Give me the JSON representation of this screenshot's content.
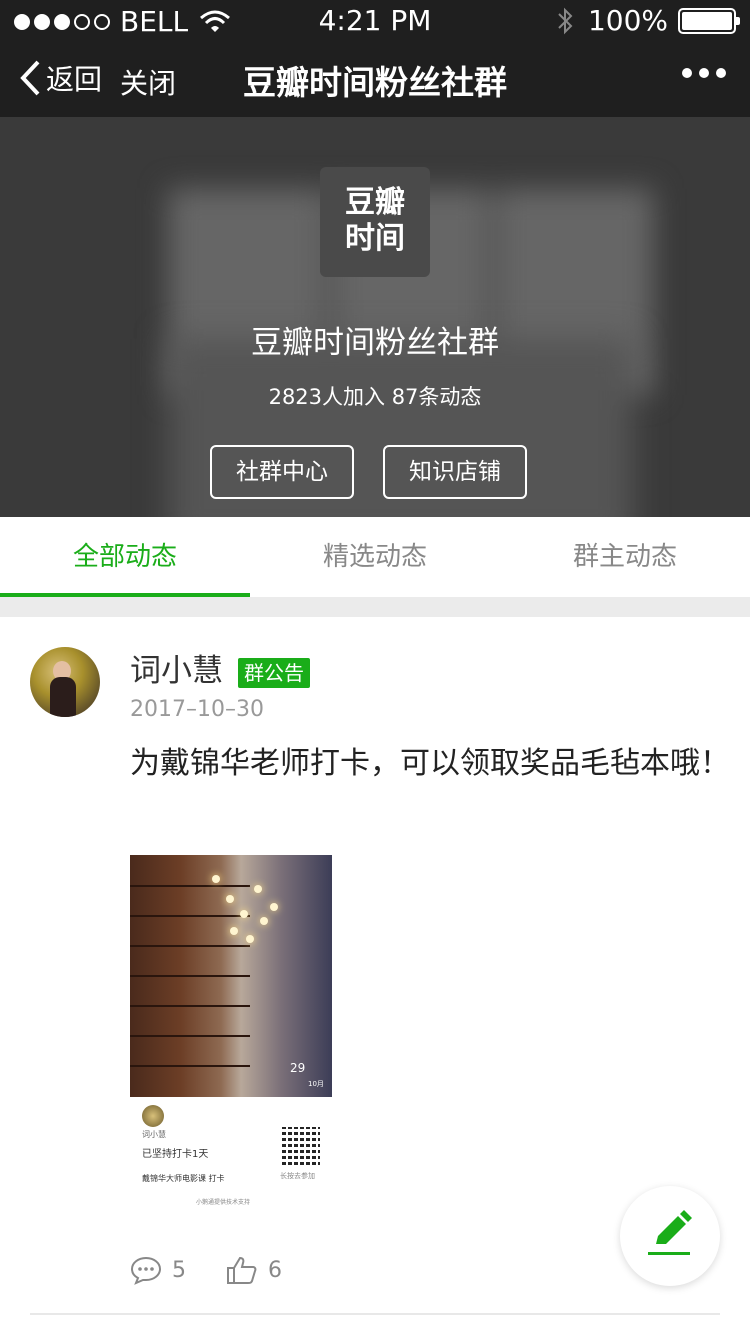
{
  "status_bar": {
    "carrier": "BELL",
    "time": "4:21 PM",
    "battery": "100%"
  },
  "nav": {
    "back_label": "返回",
    "close_label": "关闭",
    "title": "豆瓣时间粉丝社群"
  },
  "header": {
    "logo_line1": "豆瓣",
    "logo_line2": "时间",
    "group_name": "豆瓣时间粉丝社群",
    "stats": "2823人加入 87条动态",
    "btn_community": "社群中心",
    "btn_shop": "知识店铺"
  },
  "tabs": [
    "全部动态",
    "精选动态",
    "群主动态"
  ],
  "post": {
    "author": "词小慧",
    "badge": "群公告",
    "date": "2017–10–30",
    "content": "为戴锦华老师打卡，可以领取奖品毛毡本哦！",
    "image": {
      "date_day": "29",
      "date_month": "10月",
      "name": "词小慧",
      "days": "已坚持打卡1天",
      "course": "戴锦华大师电影课 打卡",
      "scan": "长按去参加",
      "footer": "小鹅通提供技术支持"
    },
    "comments": "5",
    "likes": "6"
  },
  "colors": {
    "accent": "#1aad19",
    "nav_bg": "#1f1f1f"
  },
  "icons": [
    "wifi-icon",
    "bluetooth-icon",
    "battery-icon",
    "back-chevron-icon",
    "more-icon",
    "comment-icon",
    "thumbs-up-icon",
    "edit-icon"
  ]
}
